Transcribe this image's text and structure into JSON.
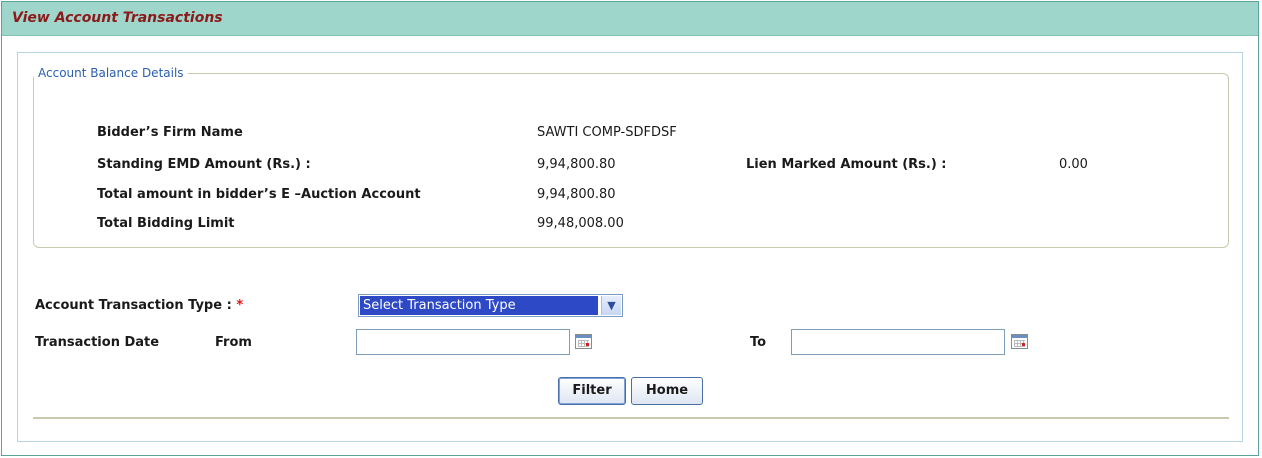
{
  "panel": {
    "title": "View Account Transactions"
  },
  "balance": {
    "legend": "Account Balance Details",
    "firm_name_label": "Bidder’s Firm Name",
    "firm_name_value": "SAWTI COMP-SDFDSF",
    "emd_label": "Standing EMD Amount (Rs.) :",
    "emd_value": "9,94,800.80",
    "lien_label": "Lien Marked Amount (Rs.) :",
    "lien_value": "0.00",
    "total_label": "Total amount in bidder’s E –Auction Account",
    "total_value": "9,94,800.80",
    "limit_label": "Total Bidding Limit",
    "limit_value": "99,48,008.00"
  },
  "filters": {
    "type_label": "Account Transaction Type :",
    "required_mark": "*",
    "type_selected": "Select Transaction Type",
    "date_label": "Transaction Date",
    "from_label": "From",
    "to_label": "To",
    "from_value": "",
    "to_value": ""
  },
  "buttons": {
    "filter": "Filter",
    "home": "Home"
  },
  "icons": {
    "calendar": "calendar-icon",
    "dropdown": "chevron-down-icon"
  },
  "colors": {
    "header_bg": "#9ed6cc",
    "title": "#8b1a1a",
    "legend": "#2a5fb0",
    "select_highlight": "#2d49c6",
    "required": "#e01010"
  }
}
